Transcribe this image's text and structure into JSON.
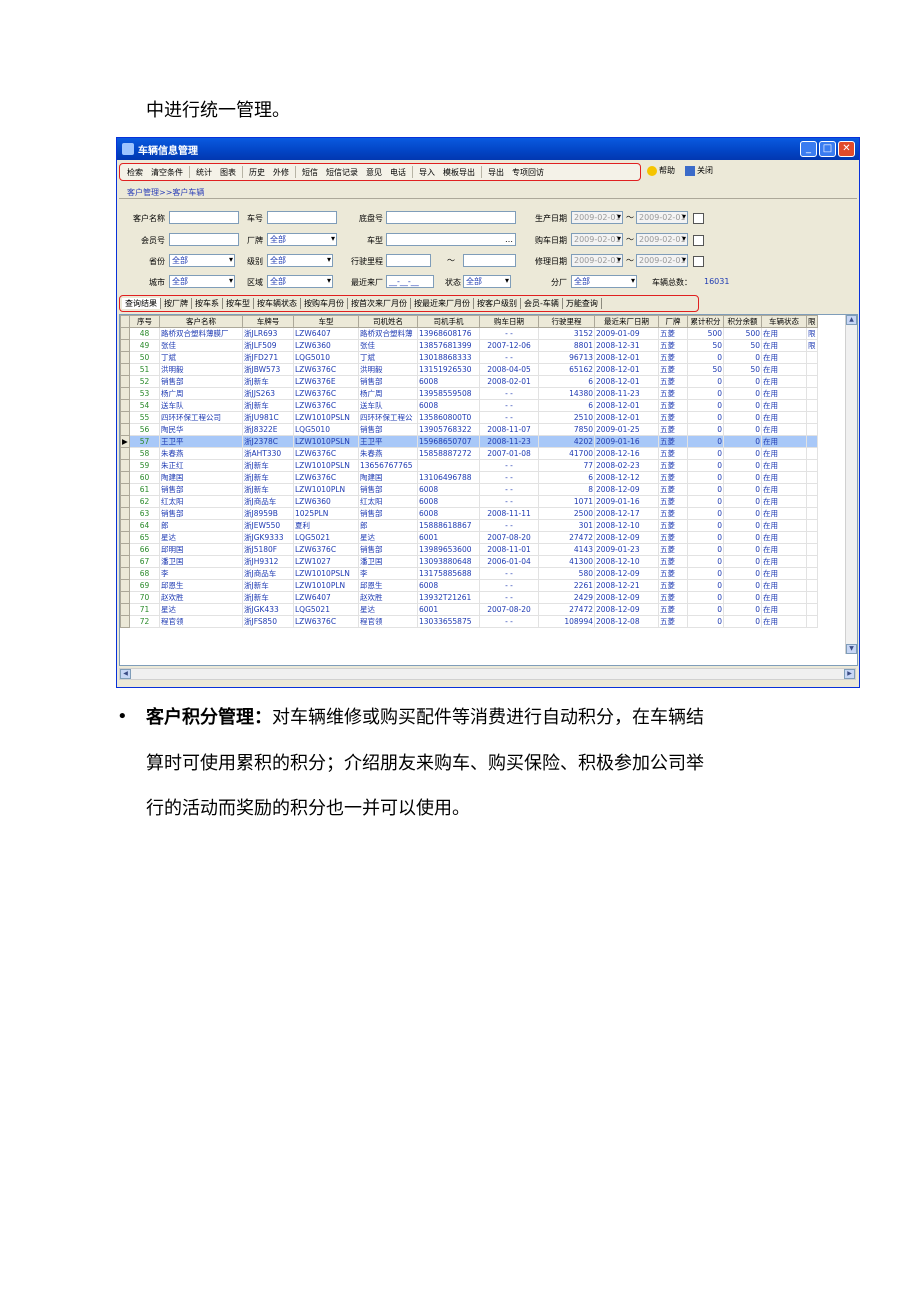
{
  "intro_text": "中进行统一管理。",
  "window": {
    "title": "车辆信息管理",
    "toolbar": [
      "检索",
      "清空条件",
      "统计",
      "图表",
      "历史",
      "外修",
      "短信",
      "短信记录",
      "意见",
      "电话",
      "导入",
      "模板导出",
      "导出",
      "专项回访"
    ],
    "help": "帮助",
    "close": "关闭",
    "breadcrumb": "客户管理>>客户车辆"
  },
  "form": {
    "customer_name": "客户名称",
    "plate": "车号",
    "chassis": "底盘号",
    "prod_date": "生产日期",
    "member_no": "会员号",
    "brand": "厂牌",
    "brand_val": "全部",
    "model": "车型",
    "buy_date": "购车日期",
    "province": "省份",
    "province_val": "全部",
    "level": "级别",
    "level_val": "全部",
    "mileage": "行驶里程",
    "tilde": "～",
    "repair_date": "修理日期",
    "city": "城市",
    "city_val": "全部",
    "district": "区域",
    "district_val": "全部",
    "last_visit": "最近来厂",
    "last_visit_val": "__-__-__",
    "status": "状态",
    "status_val": "全部",
    "branch": "分厂",
    "branch_val": "全部",
    "total_label": "车辆总数：",
    "total_val": "16031",
    "date_val": "2009-02-01"
  },
  "tabs": [
    "查询结果",
    "按厂牌",
    "按车系",
    "按车型",
    "按车辆状态",
    "按购车月份",
    "按首次来厂月份",
    "按最近来厂月份",
    "按客户级别",
    "会员-车辆",
    "万能查询"
  ],
  "columns": [
    "序号",
    "客户名称",
    "车牌号",
    "车型",
    "司机姓名",
    "司机手机",
    "购车日期",
    "行驶里程",
    "最近来厂日期",
    "厂牌",
    "累计积分",
    "积分余额",
    "车辆状态",
    "限"
  ],
  "rows": [
    [
      "48",
      "路桥双合塑料薄膜厂",
      "浙JLR693",
      "LZW6407",
      "路桥双合塑料薄",
      "13968608176",
      "- -",
      "3152",
      "2009-01-09",
      "五菱",
      "500",
      "500",
      "在用",
      "限"
    ],
    [
      "49",
      "张佳",
      "浙JLF509",
      "LZW6360",
      "张佳",
      "13857681399",
      "2007-12-06",
      "8801",
      "2008-12-31",
      "五菱",
      "50",
      "50",
      "在用",
      "限"
    ],
    [
      "50",
      "丁斌",
      "浙JFD271",
      "LQG5010",
      "丁斌",
      "13018868333",
      "- -",
      "96713",
      "2008-12-01",
      "五菱",
      "0",
      "0",
      "在用",
      ""
    ],
    [
      "51",
      "洪明毅",
      "浙JBW573",
      "LZW6376C",
      "洪明毅",
      "13151926530",
      "2008-04-05",
      "65162",
      "2008-12-01",
      "五菱",
      "50",
      "50",
      "在用",
      ""
    ],
    [
      "52",
      "销售部",
      "浙J新车",
      "LZW6376E",
      "销售部",
      "6008",
      "2008-02-01",
      "6",
      "2008-12-01",
      "五菱",
      "0",
      "0",
      "在用",
      ""
    ],
    [
      "53",
      "杨广周",
      "浙JJS263",
      "LZW6376C",
      "杨广周",
      "13958559508",
      "- -",
      "14380",
      "2008-11-23",
      "五菱",
      "0",
      "0",
      "在用",
      ""
    ],
    [
      "54",
      "送车队",
      "浙J新车",
      "LZW6376C",
      "送车队",
      "6008",
      "- -",
      "6",
      "2008-12-01",
      "五菱",
      "0",
      "0",
      "在用",
      ""
    ],
    [
      "55",
      "四环环保工程公司",
      "浙JU981C",
      "LZW1010PSLN",
      "四环环保工程公",
      "135860800T0",
      "- -",
      "2510",
      "2008-12-01",
      "五菱",
      "0",
      "0",
      "在用",
      ""
    ],
    [
      "56",
      "陶民华",
      "浙J8322E",
      "LQG5010",
      "销售部",
      "13905768322",
      "2008-11-07",
      "7850",
      "2009-01-25",
      "五菱",
      "0",
      "0",
      "在用",
      ""
    ],
    [
      "57",
      "王卫平",
      "浙J2378C",
      "LZW1010PSLN",
      "王卫平",
      "15968650707",
      "2008-11-23",
      "4202",
      "2009-01-16",
      "五菱",
      "0",
      "0",
      "在用",
      ""
    ],
    [
      "58",
      "朱春燕",
      "浙AHT330",
      "LZW6376C",
      "朱春燕",
      "15858887272",
      "2007-01-08",
      "41700",
      "2008-12-16",
      "五菱",
      "0",
      "0",
      "在用",
      ""
    ],
    [
      "59",
      "朱正红",
      "浙J新车",
      "LZW1010PSLN",
      "13656767765",
      "",
      "- -",
      "77",
      "2008-02-23",
      "五菱",
      "0",
      "0",
      "在用",
      ""
    ],
    [
      "60",
      "陶建国",
      "浙J新车",
      "LZW6376C",
      "陶建国",
      "13106496788",
      "- -",
      "6",
      "2008-12-12",
      "五菱",
      "0",
      "0",
      "在用",
      ""
    ],
    [
      "61",
      "销售部",
      "浙J新车",
      "LZW1010PLN",
      "销售部",
      "6008",
      "- -",
      "8",
      "2008-12-09",
      "五菱",
      "0",
      "0",
      "在用",
      ""
    ],
    [
      "62",
      "红太阳",
      "浙J商品车",
      "LZW6360",
      "红太阳",
      "6008",
      "- -",
      "1071",
      "2009-01-16",
      "五菱",
      "0",
      "0",
      "在用",
      ""
    ],
    [
      "63",
      "销售部",
      "浙J8959B",
      "1025PLN",
      "销售部",
      "6008",
      "2008-11-11",
      "2500",
      "2008-12-17",
      "五菱",
      "0",
      "0",
      "在用",
      ""
    ],
    [
      "64",
      "郎",
      "浙JEW550",
      "夏利",
      "郎",
      "15888618867",
      "- -",
      "301",
      "2008-12-10",
      "五菱",
      "0",
      "0",
      "在用",
      ""
    ],
    [
      "65",
      "星达",
      "浙JGK9333",
      "LQG5021",
      "星达",
      "6001",
      "2007-08-20",
      "27472",
      "2008-12-09",
      "五菱",
      "0",
      "0",
      "在用",
      ""
    ],
    [
      "66",
      "邱明国",
      "浙J5180F",
      "LZW6376C",
      "销售部",
      "13989653600",
      "2008-11-01",
      "4143",
      "2009-01-23",
      "五菱",
      "0",
      "0",
      "在用",
      ""
    ],
    [
      "67",
      "潘卫国",
      "浙JH9312",
      "LZW1027",
      "潘卫国",
      "13093880648",
      "2006-01-04",
      "41300",
      "2008-12-10",
      "五菱",
      "0",
      "0",
      "在用",
      ""
    ],
    [
      "68",
      "李",
      "浙J商品车",
      "LZW1010PSLN",
      "李",
      "13175885688",
      "- -",
      "580",
      "2008-12-09",
      "五菱",
      "0",
      "0",
      "在用",
      ""
    ],
    [
      "69",
      "邱恩生",
      "浙J新车",
      "LZW1010PLN",
      "邱恩生",
      "6008",
      "- -",
      "2261",
      "2008-12-21",
      "五菱",
      "0",
      "0",
      "在用",
      ""
    ],
    [
      "70",
      "赵欢胜",
      "浙J新车",
      "LZW6407",
      "赵欢胜",
      "13932T21261",
      "- -",
      "2429",
      "2008-12-09",
      "五菱",
      "0",
      "0",
      "在用",
      ""
    ],
    [
      "71",
      "星达",
      "浙JGK433",
      "LQG5021",
      "星达",
      "6001",
      "2007-08-20",
      "27472",
      "2008-12-09",
      "五菱",
      "0",
      "0",
      "在用",
      ""
    ],
    [
      "72",
      "程官领",
      "浙JFS850",
      "LZW6376C",
      "程官领",
      "13033655875",
      "- -",
      "108994",
      "2008-12-08",
      "五菱",
      "0",
      "0",
      "在用",
      ""
    ]
  ],
  "selected_row": "57",
  "bullet": "•",
  "para_bold": "客户积分管理：",
  "para_line1": "对车辆维修或购买配件等消费进行自动积分，在车辆结",
  "para_line2": "算时可使用累积的积分；介绍朋友来购车、购买保险、积极参加公司举",
  "para_line3": "行的活动而奖励的积分也一并可以使用。"
}
